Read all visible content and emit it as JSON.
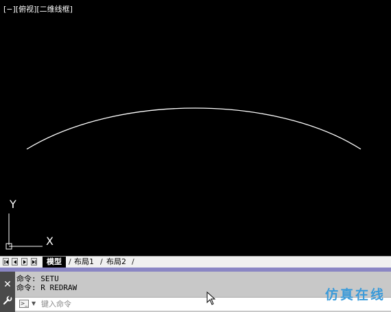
{
  "viewport": {
    "label": "[−][俯视][二维线框]",
    "background": "#000000",
    "curve_color": "#ffffff"
  },
  "ucs_icon": {
    "y_label": "Y",
    "x_label": "X"
  },
  "layout_tabs": {
    "nav_icons": [
      "first-arrow-icon",
      "prev-arrow-icon",
      "next-arrow-icon",
      "last-arrow-icon"
    ],
    "tabs": [
      {
        "label": "模型",
        "active": true
      },
      {
        "label": "布局1",
        "active": false
      },
      {
        "label": "布局2",
        "active": false
      }
    ],
    "accent_color": "#8a86c4"
  },
  "command_line": {
    "history": [
      "命令: SETU",
      "命令: R REDRAW"
    ],
    "input_value": "",
    "input_placeholder": "键入命令",
    "close_icon": "close-icon",
    "settings_icon": "wrench-icon"
  },
  "watermark": {
    "text": "仿真在线",
    "url": "www.1CAE.com",
    "color": "#3a9ad9"
  }
}
